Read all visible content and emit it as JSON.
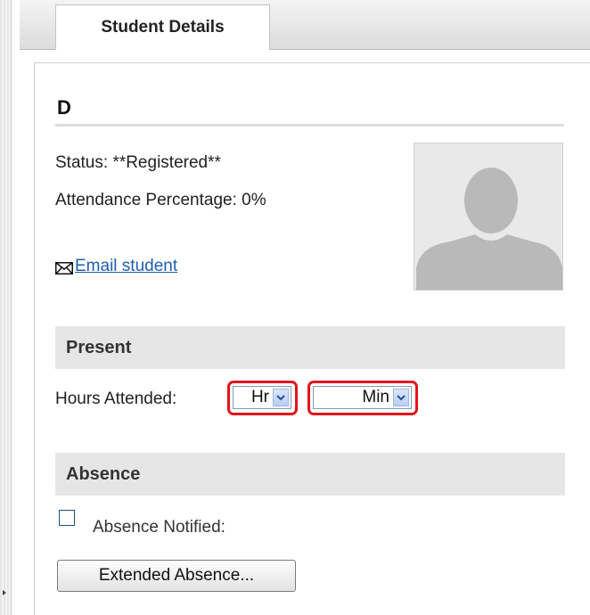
{
  "tabs": [
    {
      "label": "Student Details"
    }
  ],
  "student": {
    "name": "D",
    "status": "Status: **Registered**",
    "attendance": "Attendance Percentage: 0%",
    "email_link": "Email student"
  },
  "present": {
    "header": "Present",
    "hours_label": "Hours Attended:",
    "hour_select": "Hr",
    "min_select": "Min"
  },
  "absence": {
    "header": "Absence",
    "notified_label": "Absence Notified:",
    "notified_checked": false,
    "extended_button": "Extended Absence..."
  },
  "icons": [
    "envelope-icon",
    "avatar-placeholder-icon",
    "chevron-down-icon"
  ],
  "colors": {
    "link": "#1f5fae",
    "highlight": "#e3141c",
    "section_bg": "#e6e6e6"
  }
}
